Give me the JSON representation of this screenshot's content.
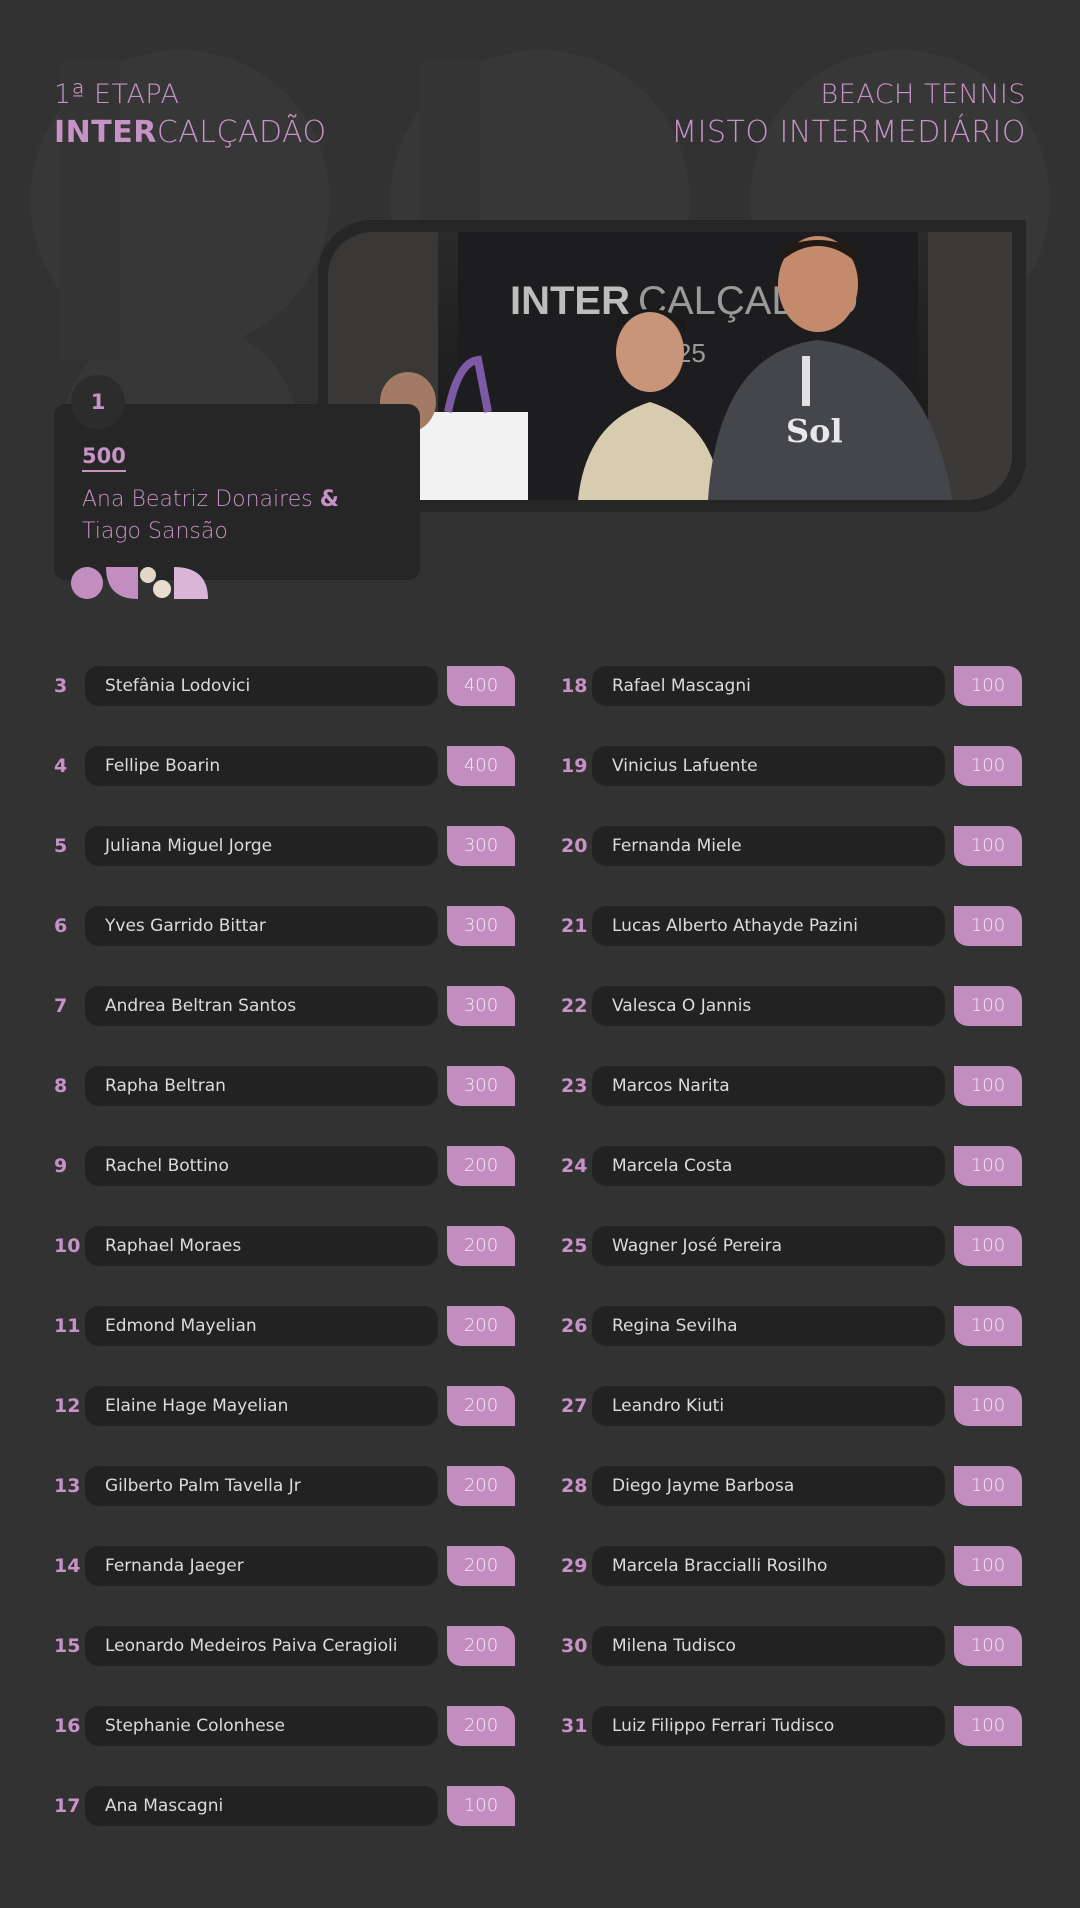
{
  "header": {
    "left_line1": "1ª ETAPA",
    "left_brand_bold": "INTER",
    "left_brand_light": "CALÇADÃO",
    "right_line1": "BEACH TENNIS",
    "right_line2": "MISTO INTERMEDIÁRIO"
  },
  "photo": {
    "banner_bold": "INTER",
    "banner_light": "CALÇADÃO",
    "banner_year": "2025",
    "shirt_text": "Sol"
  },
  "winner": {
    "rank": "1",
    "points": "500",
    "name1": "Ana Beatriz Donaires",
    "amp": "&",
    "name2": "Tiago Sansão"
  },
  "colors": {
    "background": "#323233",
    "accent": "#c792c5",
    "pill": "#222222",
    "points_badge": "#c28ec0"
  },
  "ranking_left": [
    {
      "rank": "3",
      "name": "Stefânia Lodovici",
      "points": "400"
    },
    {
      "rank": "4",
      "name": "Fellipe Boarin",
      "points": "400"
    },
    {
      "rank": "5",
      "name": "Juliana Miguel Jorge",
      "points": "300"
    },
    {
      "rank": "6",
      "name": "Yves Garrido Bittar",
      "points": "300"
    },
    {
      "rank": "7",
      "name": "Andrea Beltran Santos",
      "points": "300"
    },
    {
      "rank": "8",
      "name": "Rapha Beltran",
      "points": "300"
    },
    {
      "rank": "9",
      "name": "Rachel Bottino",
      "points": "200"
    },
    {
      "rank": "10",
      "name": "Raphael Moraes",
      "points": "200"
    },
    {
      "rank": "11",
      "name": "Edmond Mayelian",
      "points": "200"
    },
    {
      "rank": "12",
      "name": "Elaine Hage Mayelian",
      "points": "200"
    },
    {
      "rank": "13",
      "name": "Gilberto Palm Tavella Jr",
      "points": "200"
    },
    {
      "rank": "14",
      "name": "Fernanda Jaeger",
      "points": "200"
    },
    {
      "rank": "15",
      "name": "Leonardo Medeiros Paiva Ceragioli",
      "points": "200"
    },
    {
      "rank": "16",
      "name": "Stephanie Colonhese",
      "points": "200"
    },
    {
      "rank": "17",
      "name": "Ana Mascagni",
      "points": "100"
    }
  ],
  "ranking_right": [
    {
      "rank": "18",
      "name": "Rafael Mascagni",
      "points": "100"
    },
    {
      "rank": "19",
      "name": "Vinicius Lafuente",
      "points": "100"
    },
    {
      "rank": "20",
      "name": "Fernanda Miele",
      "points": "100"
    },
    {
      "rank": "21",
      "name": "Lucas Alberto Athayde Pazini",
      "points": "100"
    },
    {
      "rank": "22",
      "name": "Valesca O Jannis",
      "points": "100"
    },
    {
      "rank": "23",
      "name": "Marcos Narita",
      "points": "100"
    },
    {
      "rank": "24",
      "name": "Marcela Costa",
      "points": "100"
    },
    {
      "rank": "25",
      "name": "Wagner José Pereira",
      "points": "100"
    },
    {
      "rank": "26",
      "name": "Regina Sevilha",
      "points": "100"
    },
    {
      "rank": "27",
      "name": "Leandro Kiuti",
      "points": "100"
    },
    {
      "rank": "28",
      "name": "Diego Jayme Barbosa",
      "points": "100"
    },
    {
      "rank": "29",
      "name": "Marcela Braccialli Rosilho",
      "points": "100"
    },
    {
      "rank": "30",
      "name": "Milena Tudisco",
      "points": "100"
    },
    {
      "rank": "31",
      "name": "Luiz Filippo Ferrari Tudisco",
      "points": "100"
    }
  ]
}
